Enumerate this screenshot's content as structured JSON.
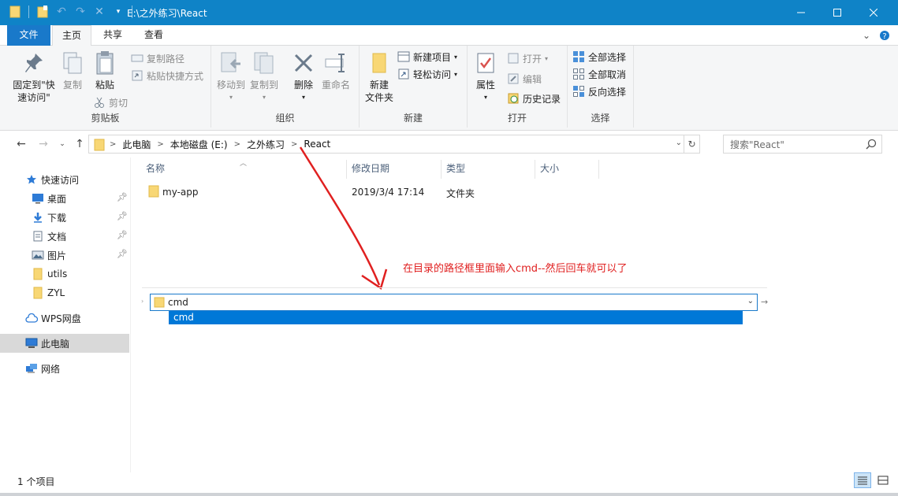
{
  "window": {
    "title": "E:\\之外练习\\React"
  },
  "ribbon_tabs": [
    {
      "label": "文件"
    },
    {
      "label": "主页"
    },
    {
      "label": "共享"
    },
    {
      "label": "查看"
    }
  ],
  "ribbon": {
    "clipboard": {
      "group_label": "剪贴板",
      "pin_label_line1": "固定到\"快",
      "pin_label_line2": "速访问\"",
      "copy_label": "复制",
      "paste_label": "粘贴",
      "copy_path_label": "复制路径",
      "paste_shortcut_label": "粘贴快捷方式",
      "cut_label": "剪切"
    },
    "organize": {
      "group_label": "组织",
      "move_to_label": "移动到",
      "copy_to_label": "复制到",
      "delete_label": "删除",
      "rename_label": "重命名"
    },
    "new": {
      "group_label": "新建",
      "new_folder_line1": "新建",
      "new_folder_line2": "文件夹",
      "new_item_label": "新建项目",
      "easy_access_label": "轻松访问"
    },
    "open": {
      "group_label": "打开",
      "properties_label": "属性",
      "open_label": "打开",
      "edit_label": "编辑",
      "history_label": "历史记录"
    },
    "select": {
      "group_label": "选择",
      "select_all_label": "全部选择",
      "select_none_label": "全部取消",
      "invert_label": "反向选择"
    }
  },
  "address_bar": {
    "breadcrumbs": [
      "此电脑",
      "本地磁盘 (E:)",
      "之外练习",
      "React"
    ],
    "search_placeholder": "搜索\"React\""
  },
  "sidebar": {
    "quick_access_label": "快速访问",
    "items": [
      {
        "label": "桌面",
        "icon": "desktop-icon",
        "pinned": true
      },
      {
        "label": "下载",
        "icon": "download-icon",
        "pinned": true
      },
      {
        "label": "文档",
        "icon": "document-icon",
        "pinned": true
      },
      {
        "label": "图片",
        "icon": "pictures-icon",
        "pinned": true
      },
      {
        "label": "utils",
        "icon": "folder-icon",
        "pinned": false
      },
      {
        "label": "ZYL",
        "icon": "folder-icon",
        "pinned": false
      }
    ],
    "wps_label": "WPS网盘",
    "this_pc_label": "此电脑",
    "network_label": "网络"
  },
  "file_list": {
    "columns": [
      "名称",
      "修改日期",
      "类型",
      "大小"
    ],
    "rows": [
      {
        "name": "my-app",
        "modified": "2019/3/4 17:14",
        "type": "文件夹",
        "size": ""
      }
    ]
  },
  "address_editor": {
    "value": "cmd",
    "suggestion": "cmd"
  },
  "annotation": {
    "text": "在目录的路径框里面输入cmd--然后回车就可以了"
  },
  "status_bar": {
    "item_count": "1 个项目"
  },
  "colors": {
    "titlebar": "#0f83c7",
    "file_tab": "#1979ca",
    "selection": "#0078d7",
    "annotation": "#e02020",
    "folder": "#f8d775"
  }
}
